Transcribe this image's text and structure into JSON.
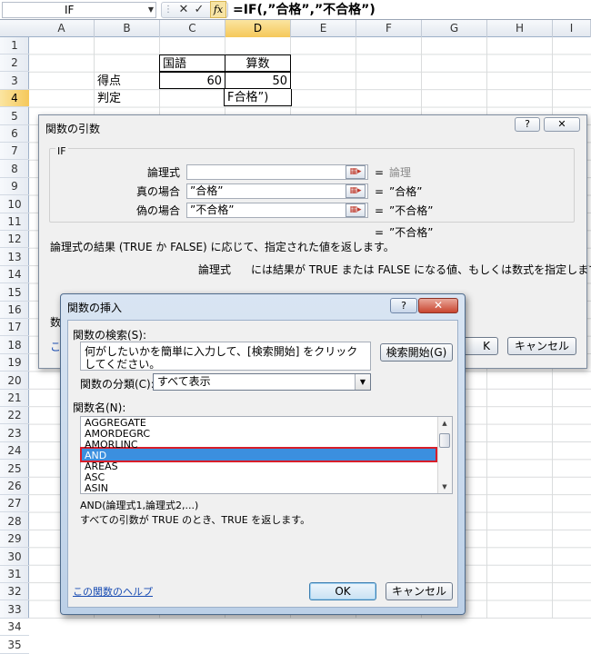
{
  "formula_bar": {
    "name_box": "IF",
    "fx_label": "fx",
    "cancel_glyph": "✕",
    "enter_glyph": "✓",
    "formula": "=IF(,”合格”,”不合格”)"
  },
  "columns": [
    "A",
    "B",
    "C",
    "D",
    "E",
    "F",
    "G",
    "H",
    "I"
  ],
  "selected_column": "D",
  "rows": [
    "1",
    "2",
    "3",
    "4",
    "5",
    "6",
    "7",
    "8",
    "9",
    "10",
    "11",
    "12",
    "13",
    "14",
    "15",
    "16",
    "17",
    "18",
    "19",
    "20",
    "21",
    "22",
    "23",
    "24",
    "25",
    "26",
    "27",
    "28",
    "29",
    "30",
    "31",
    "32",
    "33",
    "34",
    "35"
  ],
  "selected_row": "4",
  "cells": {
    "c2": "国語",
    "d2": "算数",
    "b3": "得点",
    "c3": "60",
    "d3": "50",
    "b4": "判定",
    "d4": "F合格”)"
  },
  "args_dialog": {
    "title": "関数の引数",
    "help_glyph": "?",
    "close_glyph": "✕",
    "function_name": "IF",
    "arguments": [
      {
        "label": "論理式",
        "value": "",
        "result": "論理",
        "result_muted": true
      },
      {
        "label": "真の場合",
        "value": "”合格”",
        "result": "”合格”",
        "result_muted": false
      },
      {
        "label": "偽の場合",
        "value": "”不合格”",
        "result": "”不合格”",
        "result_muted": false
      }
    ],
    "equals": "=",
    "overall_result": "”不合格”",
    "description": "論理式の結果 (TRUE か FALSE) に応じて、指定された値を返します。",
    "param_name": "論理式",
    "param_description": "には結果が TRUE または FALSE になる値、もしくは数式を指定します。",
    "partial_label": "数",
    "partial_help": "こ",
    "ok_label": "K",
    "cancel_label": "キャンセル"
  },
  "insert_dialog": {
    "title": "関数の挿入",
    "help_glyph": "?",
    "close_glyph": "✕",
    "search_label": "関数の検索(S):",
    "search_value": "何がしたいかを簡単に入力して、[検索開始] をクリックしてください。",
    "search_button": "検索開始(G)",
    "category_label": "関数の分類(C):",
    "category_value": "すべて表示",
    "list_label": "関数名(N):",
    "functions": [
      "AGGREGATE",
      "AMORDEGRC",
      "AMORLINC",
      "AND",
      "AREAS",
      "ASC",
      "ASIN"
    ],
    "selected_function": "AND",
    "syntax": "AND(論理式1,論理式2,...)",
    "description": "すべての引数が TRUE のとき、TRUE を返します。",
    "help_link": "この関数のヘルプ",
    "ok_label": "OK",
    "cancel_label": "キャンセル"
  }
}
